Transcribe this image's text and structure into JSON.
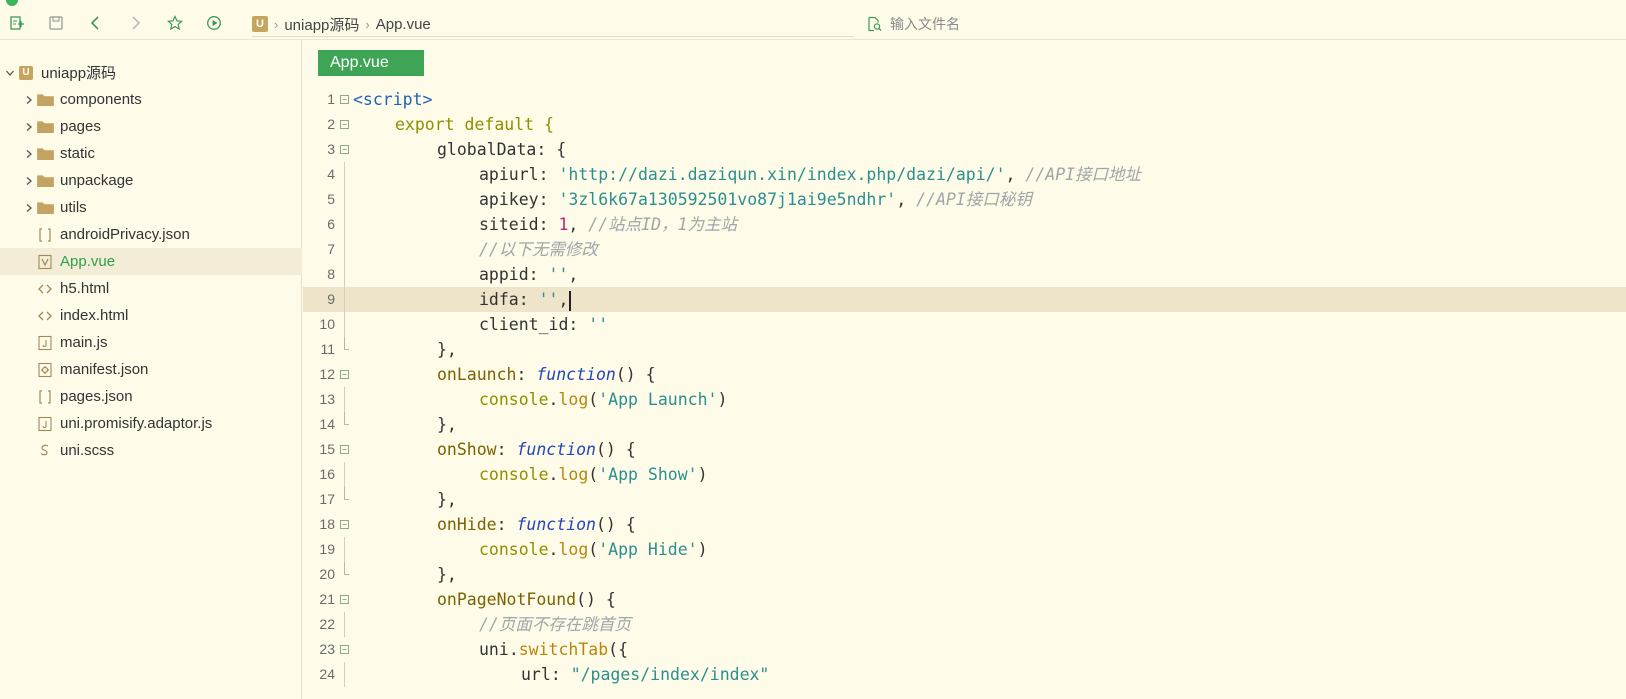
{
  "toolbar": {
    "buttons": [
      "new-file-icon",
      "save-icon",
      "back-icon",
      "forward-icon",
      "star-icon",
      "run-icon"
    ],
    "breadcrumb": {
      "project": "uniapp源码",
      "file": "App.vue"
    },
    "search": {
      "placeholder": "输入文件名"
    }
  },
  "sidebar": {
    "root": {
      "label": "uniapp源码"
    },
    "items": [
      {
        "label": "components",
        "type": "folder"
      },
      {
        "label": "pages",
        "type": "folder"
      },
      {
        "label": "static",
        "type": "folder"
      },
      {
        "label": "unpackage",
        "type": "folder"
      },
      {
        "label": "utils",
        "type": "folder"
      },
      {
        "label": "androidPrivacy.json",
        "type": "json"
      },
      {
        "label": "App.vue",
        "type": "vue",
        "selected": true
      },
      {
        "label": "h5.html",
        "type": "html"
      },
      {
        "label": "index.html",
        "type": "html"
      },
      {
        "label": "main.js",
        "type": "js"
      },
      {
        "label": "manifest.json",
        "type": "manifest"
      },
      {
        "label": "pages.json",
        "type": "json"
      },
      {
        "label": "uni.promisify.adaptor.js",
        "type": "js"
      },
      {
        "label": "uni.scss",
        "type": "scss"
      }
    ]
  },
  "editor": {
    "tab": {
      "label": "App.vue"
    },
    "lines": [
      {
        "n": "1",
        "text": "<script>"
      },
      {
        "n": "2",
        "text": "export default {"
      },
      {
        "n": "3",
        "text": "globalData: {"
      },
      {
        "n": "4",
        "key": "apiurl",
        "value": "'http://dazi.daziqun.xin/index.php/dazi/api/'",
        "comment": "//API接口地址"
      },
      {
        "n": "5",
        "key": "apikey",
        "value": "'3zl6k67a130592501vo87j1ai9e5ndhr'",
        "comment": "//API接口秘钥"
      },
      {
        "n": "6",
        "key": "siteid",
        "value": "1",
        "comment": "//站点ID，1为主站"
      },
      {
        "n": "7",
        "comment": "//以下无需修改"
      },
      {
        "n": "8",
        "key": "appid",
        "value": "''"
      },
      {
        "n": "9",
        "key": "idfa",
        "value": "''"
      },
      {
        "n": "10",
        "key": "client_id",
        "value": "''"
      },
      {
        "n": "11",
        "text": "},"
      },
      {
        "n": "12",
        "key": "onLaunch",
        "fn": "function",
        "rest": "() {"
      },
      {
        "n": "13",
        "obj": "console",
        "method": "log",
        "arg": "'App Launch'"
      },
      {
        "n": "14",
        "text": "},"
      },
      {
        "n": "15",
        "key": "onShow",
        "fn": "function",
        "rest": "() {"
      },
      {
        "n": "16",
        "obj": "console",
        "method": "log",
        "arg": "'App Show'"
      },
      {
        "n": "17",
        "text": "},"
      },
      {
        "n": "18",
        "key": "onHide",
        "fn": "function",
        "rest": "() {"
      },
      {
        "n": "19",
        "obj": "console",
        "method": "log",
        "arg": "'App Hide'"
      },
      {
        "n": "20",
        "text": "},"
      },
      {
        "n": "21",
        "key": "onPageNotFound",
        "rest": "() {"
      },
      {
        "n": "22",
        "comment": "//页面不存在跳首页"
      },
      {
        "n": "23",
        "obj": "uni",
        "method": "switchTab",
        "rest": "({"
      },
      {
        "n": "24",
        "key": "url",
        "value": "\"/pages/index/index\""
      }
    ]
  }
}
